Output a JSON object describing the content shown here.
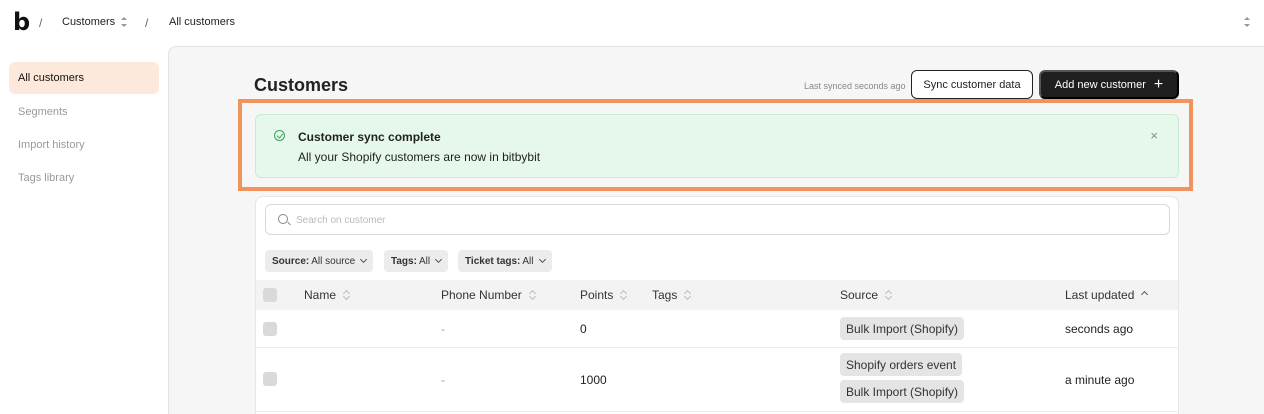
{
  "breadcrumb": {
    "logo": "b",
    "separator": "/",
    "section": "Customers",
    "page": "All customers"
  },
  "sidebar": {
    "items": [
      {
        "label": "All customers",
        "active": true
      },
      {
        "label": "Segments",
        "active": false
      },
      {
        "label": "Import history",
        "active": false
      },
      {
        "label": "Tags library",
        "active": false
      }
    ]
  },
  "header": {
    "title": "Customers",
    "last_synced": "Last synced seconds ago",
    "sync_button": "Sync customer data",
    "add_button": "Add new customer",
    "add_icon": "+"
  },
  "banner": {
    "title": "Customer sync complete",
    "message": "All your Shopify customers are now in bitbybit",
    "close": "×",
    "accent": "#3aa35c",
    "highlight_color": "#f0935f"
  },
  "search": {
    "placeholder": "Search on customer",
    "value": ""
  },
  "filters": [
    {
      "label": "Source:",
      "value": "All source"
    },
    {
      "label": "Tags:",
      "value": "All"
    },
    {
      "label": "Ticket tags:",
      "value": "All"
    }
  ],
  "table": {
    "columns": [
      "Name",
      "Phone Number",
      "Points",
      "Tags",
      "Source",
      "Last updated"
    ],
    "rows": [
      {
        "name": "",
        "phone": "-",
        "points": "0",
        "tags": "",
        "sources": [
          "Bulk Import (Shopify)"
        ],
        "last_updated": "seconds ago"
      },
      {
        "name": "",
        "phone": "-",
        "points": "1000",
        "tags": "",
        "sources": [
          "Shopify orders event",
          "Bulk Import (Shopify)"
        ],
        "last_updated": "a minute ago"
      }
    ]
  }
}
